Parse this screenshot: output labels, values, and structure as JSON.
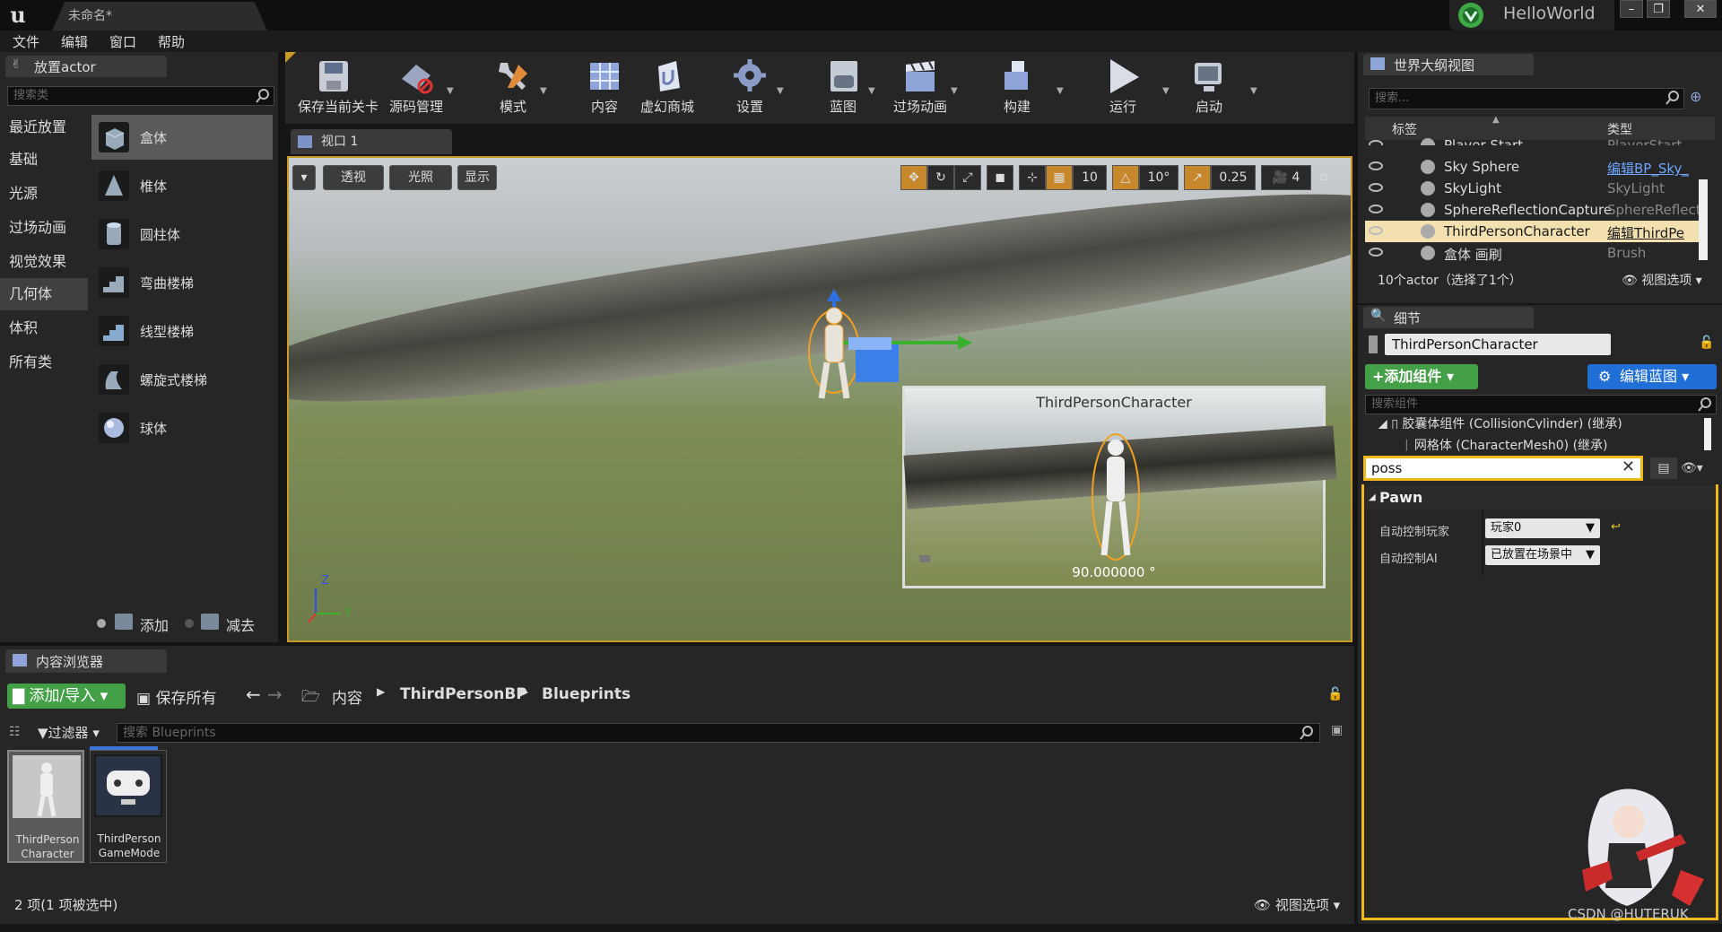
{
  "window": {
    "doc_tab": "未命名*",
    "project": "HelloWorld",
    "controls": [
      "–",
      "❐",
      "✕"
    ]
  },
  "menu": [
    "文件",
    "编辑",
    "窗口",
    "帮助"
  ],
  "place_actor": {
    "tab": "放置actor",
    "search_placeholder": "搜索类",
    "categories": [
      "最近放置",
      "基础",
      "光源",
      "过场动画",
      "视觉效果",
      "几何体",
      "体积",
      "所有类"
    ],
    "active_category": "几何体",
    "shapes": [
      "盒体",
      "椎体",
      "圆柱体",
      "弯曲楼梯",
      "线型楼梯",
      "螺旋式楼梯",
      "球体"
    ],
    "active_shape": "盒体",
    "add_label": "添加",
    "subtract_label": "减去"
  },
  "toolbar": {
    "items": [
      "保存当前关卡",
      "源码管理",
      "模式",
      "内容",
      "虚幻商城",
      "设置",
      "蓝图",
      "过场动画",
      "构建",
      "运行",
      "启动"
    ]
  },
  "viewport": {
    "tab": "视口 1",
    "perspective": "透视",
    "lit": "光照",
    "show": "显示",
    "grid_snap": "10",
    "rot_snap": "10°",
    "scale_snap": "0.25",
    "cam_speed": "4",
    "preview_title": "ThirdPersonCharacter",
    "preview_angle": "90.000000 °",
    "axis_z": "Z",
    "axis_y": "Y"
  },
  "outliner": {
    "tab": "世界大纲视图",
    "search_placeholder": "搜索...",
    "col_label": "标签",
    "col_type": "类型",
    "rows": [
      {
        "name": "Player Start",
        "type": "PlayerStart",
        "link": false
      },
      {
        "name": "Sky Sphere",
        "type": "编辑BP_Sky_",
        "link": true
      },
      {
        "name": "SkyLight",
        "type": "SkyLight",
        "link": false
      },
      {
        "name": "SphereReflectionCapture",
        "type": "SphereReflecti",
        "link": false
      },
      {
        "name": "ThirdPersonCharacter",
        "type": "编辑ThirdPe",
        "link": true
      },
      {
        "name": "盒体 画刷",
        "type": "Brush",
        "link": false
      }
    ],
    "selected_index": 4,
    "status": "10个actor（选择了1个）",
    "view_options": "视图选项"
  },
  "details": {
    "tab": "细节",
    "actor_name": "ThirdPersonCharacter",
    "add_component": "+添加组件",
    "edit_blueprint": "编辑蓝图",
    "comp_search_placeholder": "搜索组件",
    "components": [
      "胶囊体组件 (CollisionCylinder) (继承)",
      "网格体 (CharacterMesh0) (继承)"
    ],
    "filter_value": "poss",
    "section": "Pawn",
    "props": [
      {
        "label": "自动控制玩家",
        "value": "玩家0"
      },
      {
        "label": "自动控制AI",
        "value": "已放置在场景中"
      }
    ]
  },
  "content_browser": {
    "tab": "内容浏览器",
    "add_import": "添加/导入",
    "save_all": "保存所有",
    "path": [
      "内容",
      "ThirdPersonBP",
      "Blueprints"
    ],
    "filters": "过滤器",
    "search_placeholder": "搜索 Blueprints",
    "assets": [
      {
        "name_line1": "ThirdPerson",
        "name_line2": "Character"
      },
      {
        "name_line1": "ThirdPerson",
        "name_line2": "GameMode"
      }
    ],
    "status": "2 项(1 项被选中)",
    "view_options": "视图选项"
  },
  "watermark": "CSDN @HUTERUK",
  "colors": {
    "accent_green": "#43a047",
    "accent_blue": "#1f6fd6",
    "selection_orange": "#f0b81b"
  }
}
